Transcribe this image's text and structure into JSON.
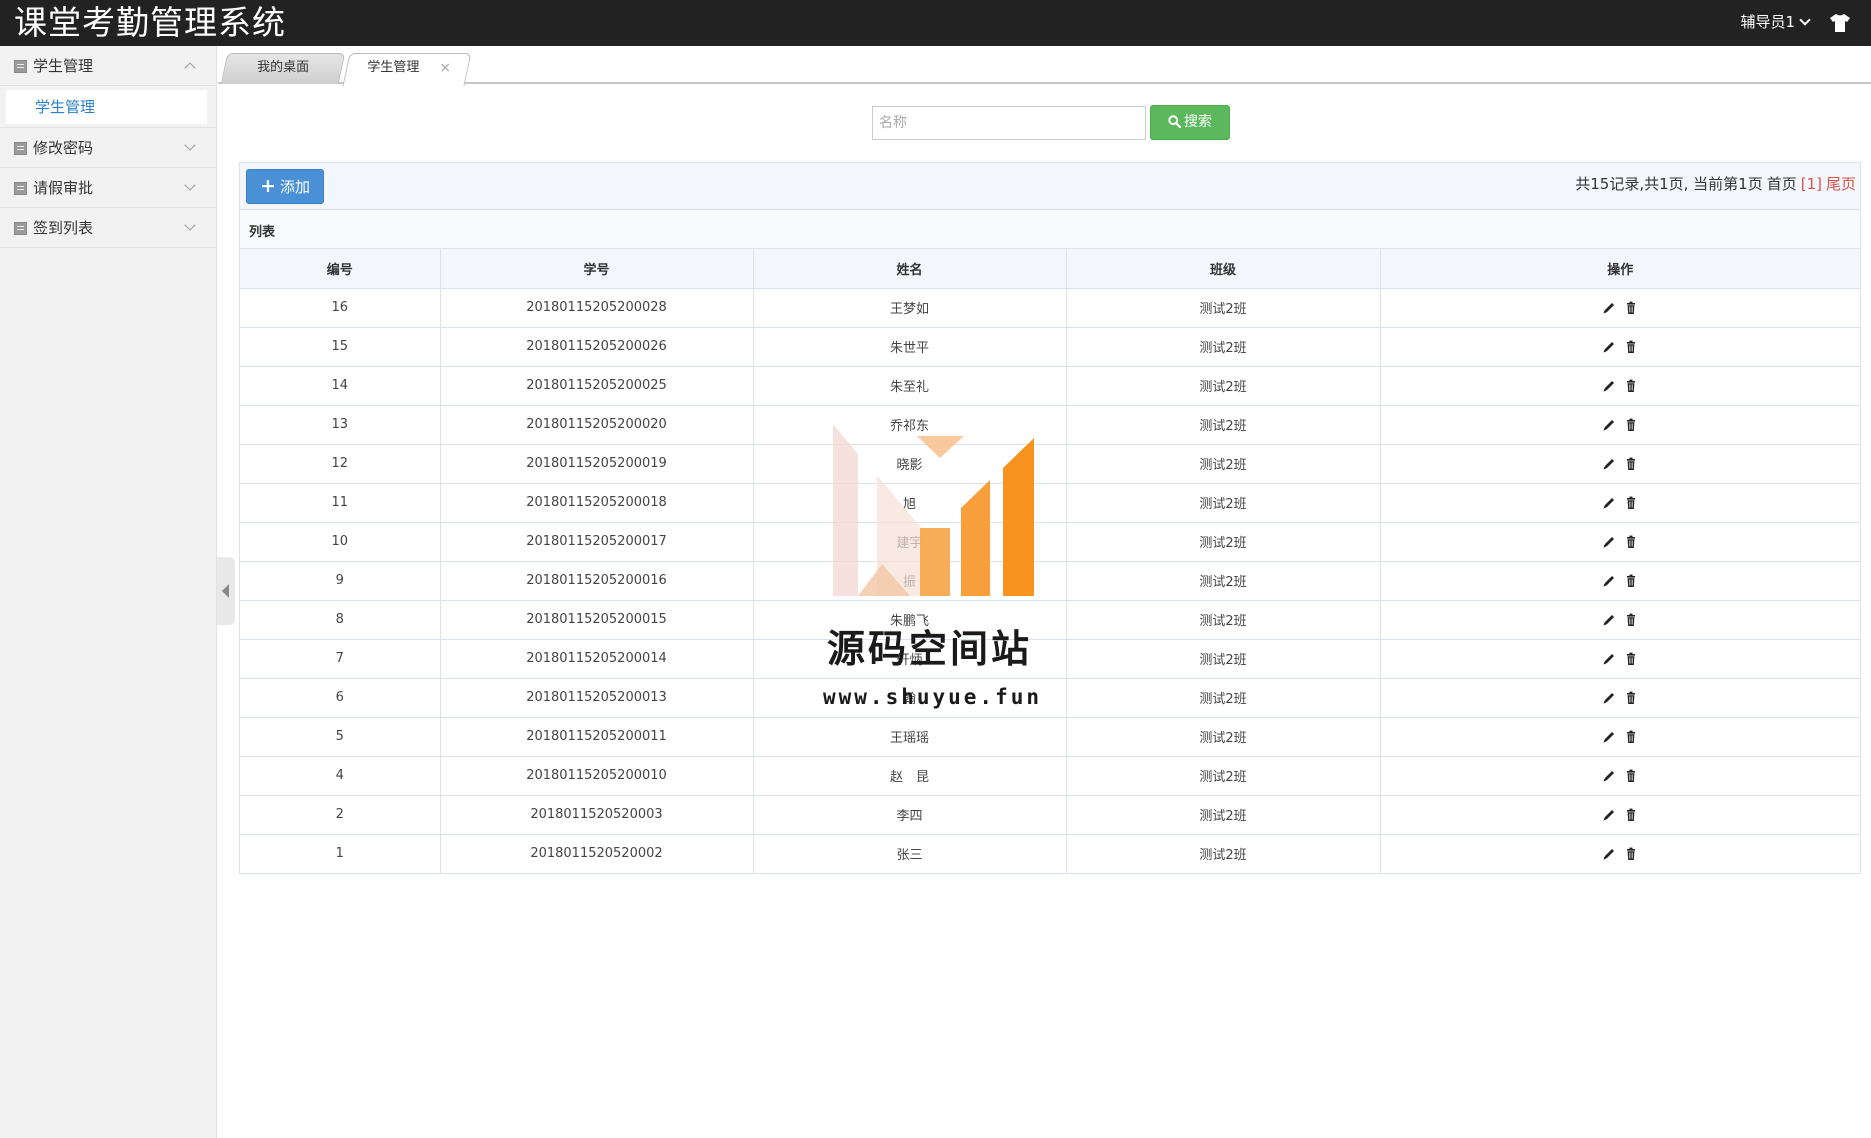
{
  "header": {
    "title": "课堂考勤管理系统",
    "user": "辅导员1",
    "user_icon": "shirt-icon"
  },
  "sidebar": {
    "groups": [
      {
        "label": "学生管理",
        "expanded": true,
        "children": [
          {
            "label": "学生管理",
            "active": true
          }
        ]
      },
      {
        "label": "修改密码",
        "expanded": false
      },
      {
        "label": "请假审批",
        "expanded": false
      },
      {
        "label": "签到列表",
        "expanded": false
      }
    ]
  },
  "tabs": [
    {
      "label": "我的桌面",
      "active": false
    },
    {
      "label": "学生管理",
      "active": true,
      "close": "×"
    }
  ],
  "search": {
    "placeholder": "名称",
    "value": "",
    "button": "搜索"
  },
  "toolbar": {
    "add_label": "添加",
    "pager_summary": "共15记录,共1页, 当前第1页",
    "pager_first": "首页",
    "pager_current": "[1]",
    "pager_last": "尾页"
  },
  "list": {
    "caption": "列表",
    "columns": [
      "编号",
      "学号",
      "姓名",
      "班级",
      "操作"
    ],
    "rows": [
      {
        "id": "16",
        "student_no": "20180115205200028",
        "name": "王梦如",
        "class": "测试2班"
      },
      {
        "id": "15",
        "student_no": "20180115205200026",
        "name": "朱世平",
        "class": "测试2班"
      },
      {
        "id": "14",
        "student_no": "20180115205200025",
        "name": "朱至礼",
        "class": "测试2班"
      },
      {
        "id": "13",
        "student_no": "20180115205200020",
        "name": "乔祁东",
        "class": "测试2班"
      },
      {
        "id": "12",
        "student_no": "20180115205200019",
        "name": "晓影",
        "class": "测试2班"
      },
      {
        "id": "11",
        "student_no": "20180115205200018",
        "name": "旭",
        "class": "测试2班"
      },
      {
        "id": "10",
        "student_no": "20180115205200017",
        "name": "建宇",
        "class": "测试2班"
      },
      {
        "id": "9",
        "student_no": "20180115205200016",
        "name": "振",
        "class": "测试2班"
      },
      {
        "id": "8",
        "student_no": "20180115205200015",
        "name": "朱鹏飞",
        "class": "测试2班"
      },
      {
        "id": "7",
        "student_no": "20180115205200014",
        "name": "轩炳",
        "class": "测试2班"
      },
      {
        "id": "6",
        "student_no": "20180115205200013",
        "name": "翰",
        "class": "测试2班"
      },
      {
        "id": "5",
        "student_no": "20180115205200011",
        "name": "王瑶瑶",
        "class": "测试2班"
      },
      {
        "id": "4",
        "student_no": "20180115205200010",
        "name": "赵　昆",
        "class": "测试2班"
      },
      {
        "id": "2",
        "student_no": "2018011520520003",
        "name": "李四",
        "class": "测试2班"
      },
      {
        "id": "1",
        "student_no": "2018011520520002",
        "name": "张三",
        "class": "测试2班"
      }
    ],
    "row_actions": [
      "edit-icon",
      "delete-icon"
    ]
  },
  "watermark": {
    "title": "源码空间站",
    "url": "www.shuyue.fun"
  },
  "colors": {
    "topbar": "#222222",
    "search_button": "#5cb85c",
    "add_button": "#4a90d6",
    "link_active": "#2a83c8",
    "pager_highlight": "#d9534f",
    "watermark_orange": "#f7931e"
  }
}
